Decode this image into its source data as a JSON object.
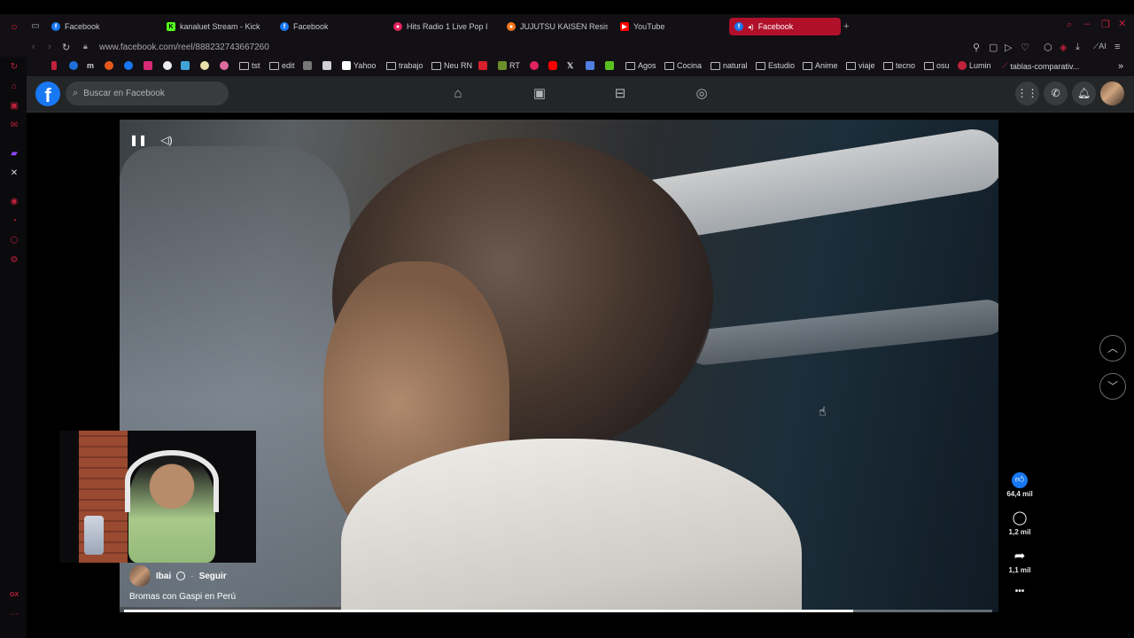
{
  "browser": {
    "tabs": [
      {
        "label": "Facebook",
        "fav_color": "#1877f2",
        "active": false
      },
      {
        "label": "kanaluet Stream - Kick",
        "fav_color": "#53fc18",
        "active": false
      },
      {
        "label": "Facebook",
        "fav_color": "#1877f2",
        "active": false
      },
      {
        "label": "Hits Radio 1 Live Pop I",
        "fav_color": "#e0245e",
        "active": false
      },
      {
        "label": "JUJUTSU KAISEN Resist",
        "fav_color": "#f47521",
        "active": false
      },
      {
        "label": "YouTube",
        "fav_color": "#ff0000",
        "active": false
      },
      {
        "label": "Facebook",
        "fav_color": "#1877f2",
        "active": true
      }
    ],
    "new_tab_label": "+",
    "url": "www.facebook.com/reel/888232743667260",
    "bookmarks": [
      {
        "label": "tst",
        "type": "folder"
      },
      {
        "label": "edit",
        "type": "folder"
      },
      {
        "label": "Yahoo",
        "type": "site"
      },
      {
        "label": "trabajo",
        "type": "folder"
      },
      {
        "label": "Neu RN",
        "type": "folder"
      },
      {
        "label": "RT",
        "type": "site"
      },
      {
        "label": "Agos",
        "type": "folder"
      },
      {
        "label": "Cocina",
        "type": "folder"
      },
      {
        "label": "natural",
        "type": "folder"
      },
      {
        "label": "Estudio",
        "type": "folder"
      },
      {
        "label": "Anime",
        "type": "folder"
      },
      {
        "label": "viaje",
        "type": "folder"
      },
      {
        "label": "tecno",
        "type": "folder"
      },
      {
        "label": "osu",
        "type": "folder"
      },
      {
        "label": "Lumin",
        "type": "site"
      },
      {
        "label": "tablas-comparativ...",
        "type": "site"
      }
    ],
    "accent_color": "#c0223a"
  },
  "facebook": {
    "logo_letter": "f",
    "search_placeholder": "Buscar en Facebook",
    "nav_icons": [
      "home-icon",
      "video-icon",
      "marketplace-icon",
      "groups-icon"
    ],
    "right_icons": [
      "menu-grid-icon",
      "messenger-icon",
      "notifications-icon"
    ]
  },
  "reel": {
    "channel_name": "Ibai",
    "follow_separator": "·",
    "follow_label": "Seguir",
    "caption": "Bromas con Gaspi en Perú",
    "progress_fraction": 0.84,
    "likes": "64,4 mil",
    "comments": "1,2 mil",
    "shares": "1,1 mil",
    "more_label": "•••",
    "sidebar_badge": "GX"
  }
}
